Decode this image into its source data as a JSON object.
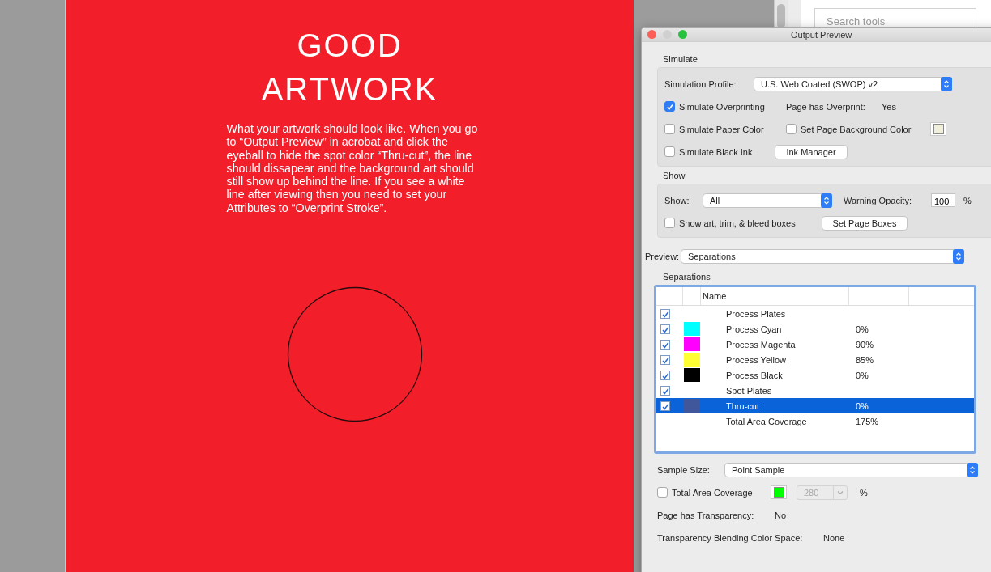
{
  "document": {
    "heading_lines": [
      "GOOD",
      "ARTWORK"
    ],
    "body": "What your artwork should look like. When you go to “Output Preview” in acrobat and click the eyeball to hide the spot color “Thru-cut”, the line should dissapear and the background art should still show up behind the line. If you see a white line after viewing then you need to set your Attributes to “Overprint Stroke”."
  },
  "tools_pane": {
    "search": {
      "placeholder": "Search tools"
    }
  },
  "dialog": {
    "title": "Output Preview",
    "simulate": {
      "label": "Simulate",
      "profile_label": "Simulation Profile:",
      "profile_value": "U.S. Web Coated (SWOP) v2",
      "overprinting": {
        "label": "Simulate Overprinting",
        "checked": true
      },
      "overprint_label": "Page has Overprint:",
      "overprint_value": "Yes",
      "paper_color": {
        "label": "Simulate Paper Color",
        "checked": false
      },
      "background_color": {
        "label": "Set Page Background Color",
        "checked": false,
        "color": "#efefdc"
      },
      "black_ink": {
        "label": "Simulate Black Ink",
        "checked": false
      },
      "ink_manager": "Ink Manager"
    },
    "show": {
      "label": "Show",
      "show_label": "Show:",
      "show_value": "All",
      "opacity_label": "Warning Opacity:",
      "opacity_value": "100",
      "percent": "%",
      "boxes": {
        "label": "Show art, trim, & bleed boxes",
        "checked": false
      },
      "set_boxes": "Set Page Boxes"
    },
    "preview": {
      "label": "Preview:",
      "value": "Separations"
    },
    "separations": {
      "label": "Separations",
      "columns": [
        "Name"
      ],
      "rows": [
        {
          "kind": "group",
          "name": "Process Plates",
          "checked": true,
          "selected": false
        },
        {
          "kind": "ink",
          "name": "Process Cyan",
          "color": "#00ffff",
          "value": "0%",
          "checked": true,
          "selected": false
        },
        {
          "kind": "ink",
          "name": "Process Magenta",
          "color": "#ff00ff",
          "value": "90%",
          "checked": true,
          "selected": false
        },
        {
          "kind": "ink",
          "name": "Process Yellow",
          "color": "#ffff33",
          "value": "85%",
          "checked": true,
          "selected": false
        },
        {
          "kind": "ink",
          "name": "Process Black",
          "color": "#000000",
          "value": "0%",
          "checked": true,
          "selected": false
        },
        {
          "kind": "group",
          "name": "Spot Plates",
          "checked": true,
          "selected": false
        },
        {
          "kind": "ink",
          "name": "Thru-cut",
          "color": "#41579b",
          "value": "0%",
          "checked": true,
          "selected": true
        },
        {
          "kind": "total",
          "name": "Total Area Coverage",
          "value": "175%"
        }
      ]
    },
    "sample": {
      "label": "Sample Size:",
      "value": "Point Sample"
    },
    "coverage": {
      "label": "Total Area Coverage",
      "checked": false,
      "color": "#00ff00",
      "value": "280",
      "percent": "%"
    },
    "transparency": {
      "label": "Page has Transparency:",
      "value": "No"
    },
    "blending": {
      "label": "Transparency Blending Color Space:",
      "value": "None"
    }
  }
}
